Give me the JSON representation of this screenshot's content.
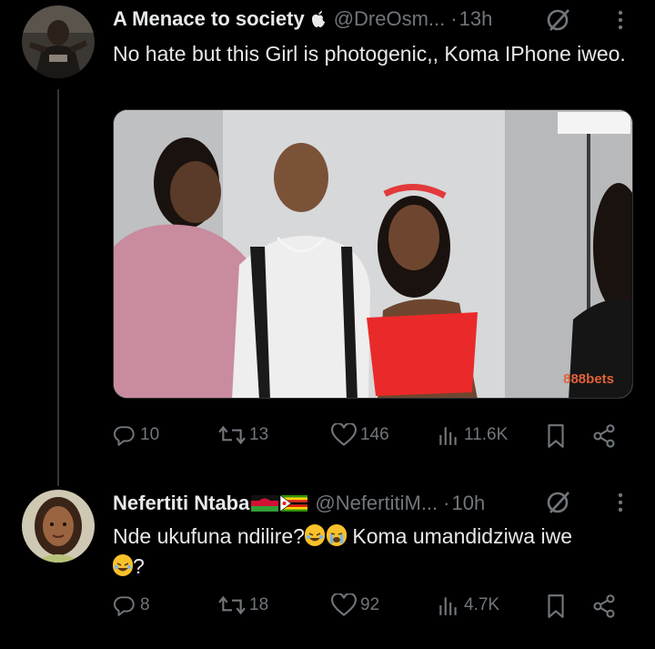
{
  "tweets": [
    {
      "name": "A Menace to society",
      "badge_icon": "apple-icon",
      "handle": "@DreOsm...",
      "dot": "·",
      "time": "13h",
      "text": "No hate but this Girl is photogenic,, Koma IPhone iweo.",
      "media_watermark": "888bets",
      "replies": "10",
      "retweets": "13",
      "likes": "146",
      "views": "11.6K"
    },
    {
      "name": "Nefertiti Ntaba",
      "flags": [
        "malawi-flag",
        "zimbabwe-flag"
      ],
      "handle": "@NefertitiM...",
      "dot": "·",
      "time": "10h",
      "text_part1": "Nde ukufuna ndilire?",
      "text_part2": " Koma umandidziwa iwe",
      "text_part3": "?",
      "replies": "8",
      "retweets": "18",
      "likes": "92",
      "views": "4.7K"
    }
  ],
  "colors": {
    "background": "#000000",
    "primary_text": "#e7e9ea",
    "secondary_text": "#71767b",
    "divider": "#333639"
  }
}
